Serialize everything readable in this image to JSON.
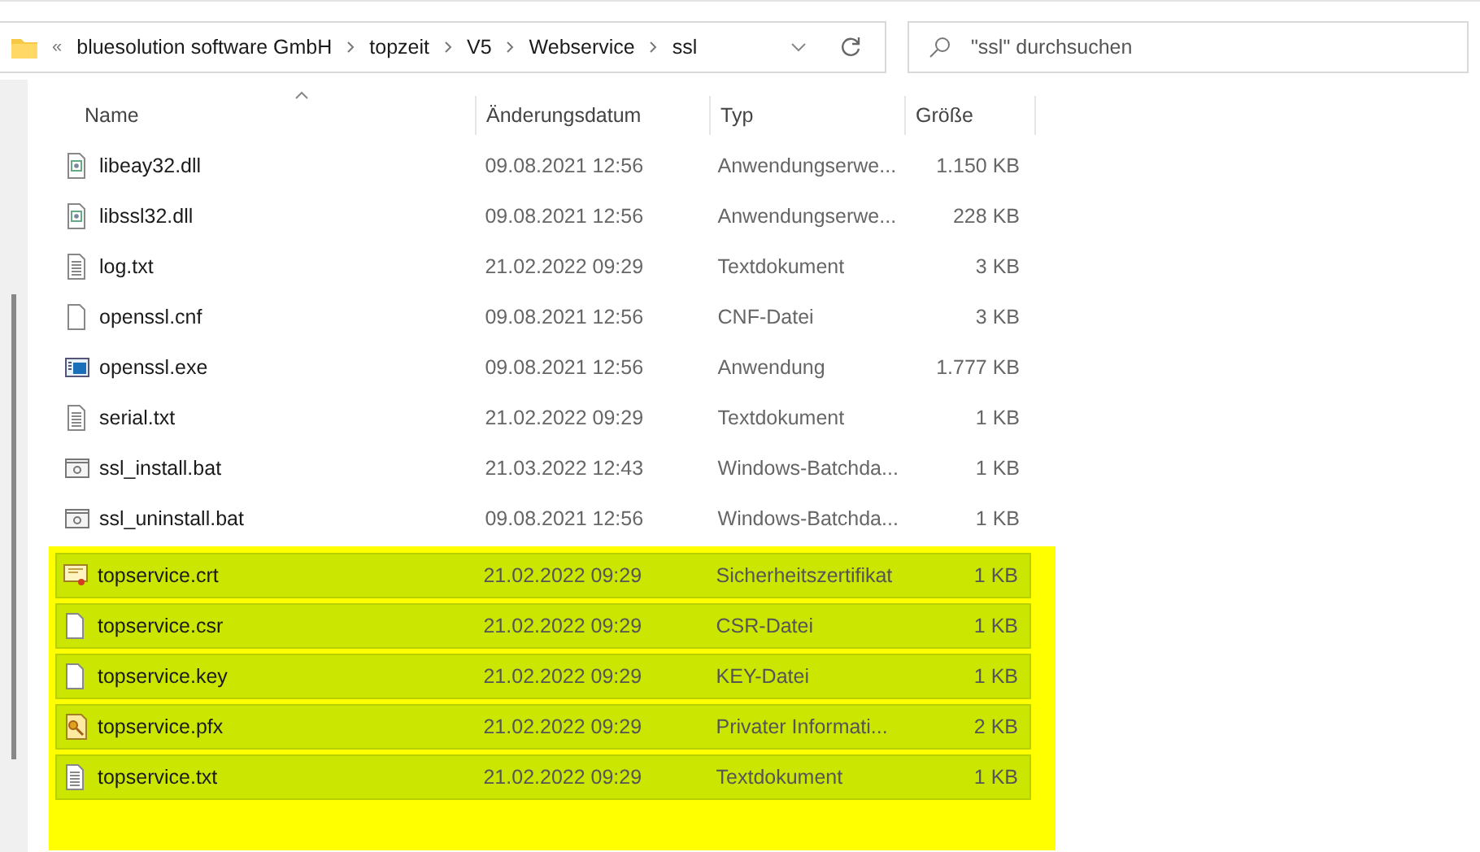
{
  "address_bar": {
    "overflow": "«",
    "path": [
      "bluesolution software GmbH",
      "topzeit",
      "V5",
      "Webservice",
      "ssl"
    ]
  },
  "search": {
    "placeholder": "\"ssl\" durchsuchen"
  },
  "columns": [
    "Name",
    "Änderungsdatum",
    "Typ",
    "Größe"
  ],
  "files": [
    {
      "name": "libeay32.dll",
      "date": "09.08.2021 12:56",
      "type": "Anwendungserwe...",
      "size": "1.150 KB",
      "kind": "library",
      "selected": false
    },
    {
      "name": "libssl32.dll",
      "date": "09.08.2021 12:56",
      "type": "Anwendungserwe...",
      "size": "228 KB",
      "kind": "library",
      "selected": false
    },
    {
      "name": "log.txt",
      "date": "21.02.2022 09:29",
      "type": "Textdokument",
      "size": "3 KB",
      "kind": "text",
      "selected": false
    },
    {
      "name": "openssl.cnf",
      "date": "09.08.2021 12:56",
      "type": "CNF-Datei",
      "size": "3 KB",
      "kind": "blank",
      "selected": false
    },
    {
      "name": "openssl.exe",
      "date": "09.08.2021 12:56",
      "type": "Anwendung",
      "size": "1.777 KB",
      "kind": "app",
      "selected": false
    },
    {
      "name": "serial.txt",
      "date": "21.02.2022 09:29",
      "type": "Textdokument",
      "size": "1 KB",
      "kind": "text",
      "selected": false
    },
    {
      "name": "ssl_install.bat",
      "date": "21.03.2022 12:43",
      "type": "Windows-Batchda...",
      "size": "1 KB",
      "kind": "batch",
      "selected": false
    },
    {
      "name": "ssl_uninstall.bat",
      "date": "09.08.2021 12:56",
      "type": "Windows-Batchda...",
      "size": "1 KB",
      "kind": "batch",
      "selected": false
    },
    {
      "name": "topservice.crt",
      "date": "21.02.2022 09:29",
      "type": "Sicherheitszertifikat",
      "size": "1 KB",
      "kind": "certificate",
      "selected": true
    },
    {
      "name": "topservice.csr",
      "date": "21.02.2022 09:29",
      "type": "CSR-Datei",
      "size": "1 KB",
      "kind": "blank",
      "selected": true
    },
    {
      "name": "topservice.key",
      "date": "21.02.2022 09:29",
      "type": "KEY-Datei",
      "size": "1 KB",
      "kind": "blank",
      "selected": true
    },
    {
      "name": "topservice.pfx",
      "date": "21.02.2022 09:29",
      "type": "Privater Informati...",
      "size": "2 KB",
      "kind": "pfx",
      "selected": true
    },
    {
      "name": "topservice.txt",
      "date": "21.02.2022 09:29",
      "type": "Textdokument",
      "size": "1 KB",
      "kind": "text",
      "selected": true
    }
  ]
}
